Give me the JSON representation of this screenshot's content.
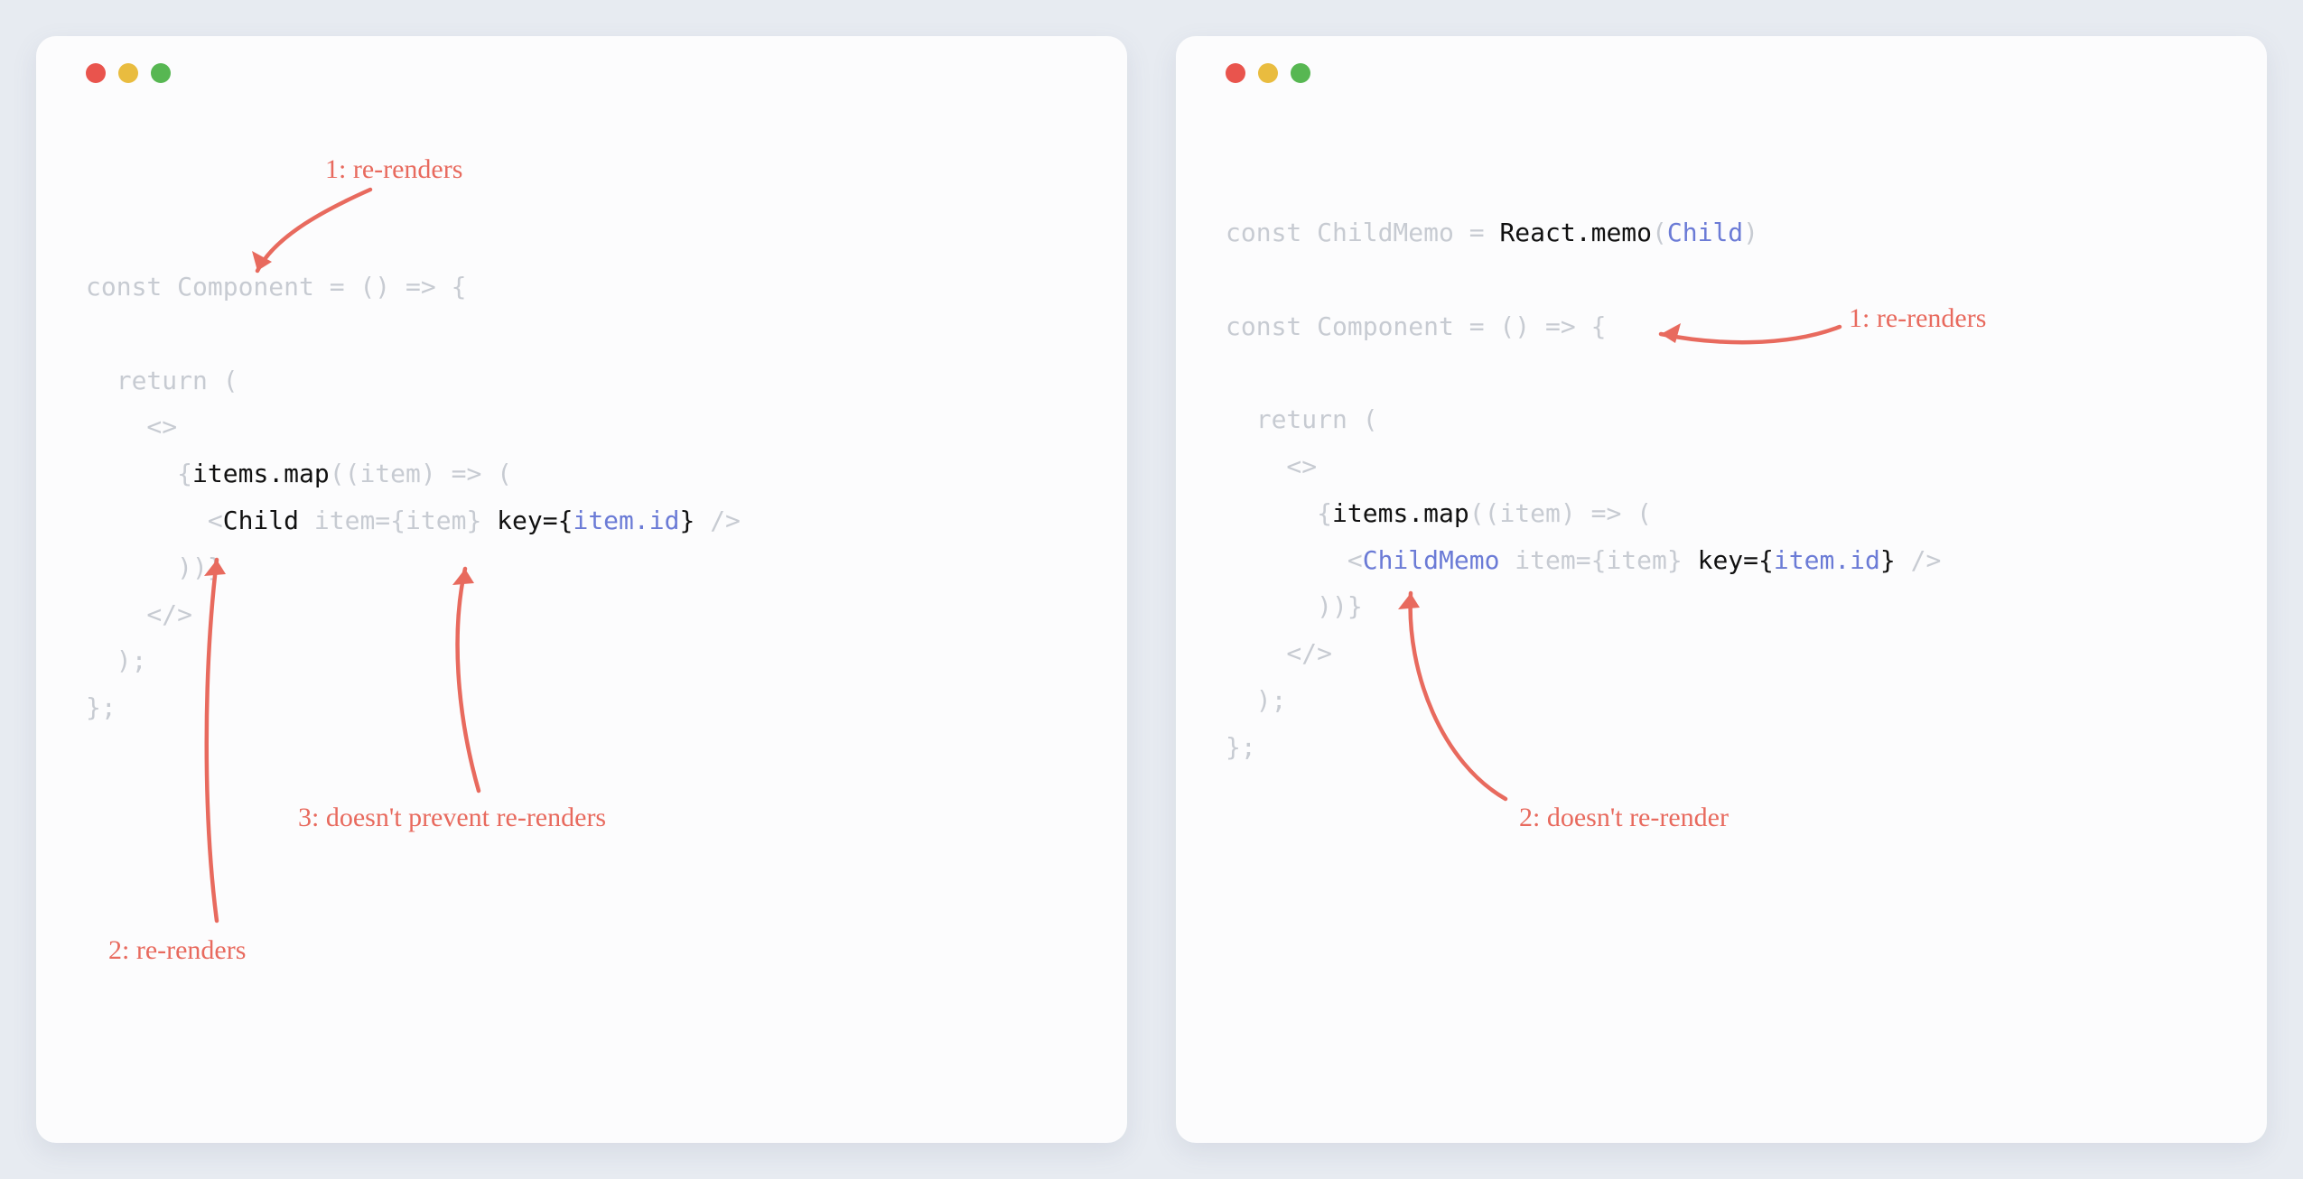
{
  "colors": {
    "background": "#e7ebf1",
    "card": "#fcfcfd",
    "muted": "#c7cbd2",
    "black": "#111",
    "blue": "#6b7bd6",
    "annotation": "#e86a5e",
    "dotRed": "#e9544d",
    "dotYellow": "#e9bc3f",
    "dotGreen": "#57b752"
  },
  "left": {
    "code": {
      "l1_a": "const Component = () => {",
      "l2": "",
      "l3_a": "  return (",
      "l4_a": "    <>",
      "l5_a": "      {",
      "l5_b": "items.map",
      "l5_c": "((item) => (",
      "l6_a": "        <",
      "l6_b": "Child",
      "l6_c": " item={item} ",
      "l6_d": "key=",
      "l6_e": "{",
      "l6_f": "item.id",
      "l6_g": "}",
      "l6_h": " />",
      "l7_a": "      ))}",
      "l8_a": "    </>",
      "l9_a": "  );",
      "l10_a": "};"
    },
    "annotations": {
      "a1": "1: re-renders",
      "a2": "2: re-renders",
      "a3": "3: doesn't prevent re-renders"
    }
  },
  "right": {
    "code": {
      "l0_a": "const ChildMemo = ",
      "l0_b": "React.memo",
      "l0_c": "(",
      "l0_d": "Child",
      "l0_e": ")",
      "l1": "",
      "l2_a": "const Component = () => {",
      "l3": "",
      "l4_a": "  return (",
      "l5_a": "    <>",
      "l6_a": "      {",
      "l6_b": "items.map",
      "l6_c": "((item) => (",
      "l7_a": "        <",
      "l7_b": "ChildMemo",
      "l7_c": " item={item} ",
      "l7_d": "key=",
      "l7_e": "{",
      "l7_f": "item.id",
      "l7_g": "}",
      "l7_h": " />",
      "l8_a": "      ))}",
      "l9_a": "    </>",
      "l10_a": "  );",
      "l11_a": "};"
    },
    "annotations": {
      "a1": "1: re-renders",
      "a2": "2: doesn't re-render"
    }
  }
}
